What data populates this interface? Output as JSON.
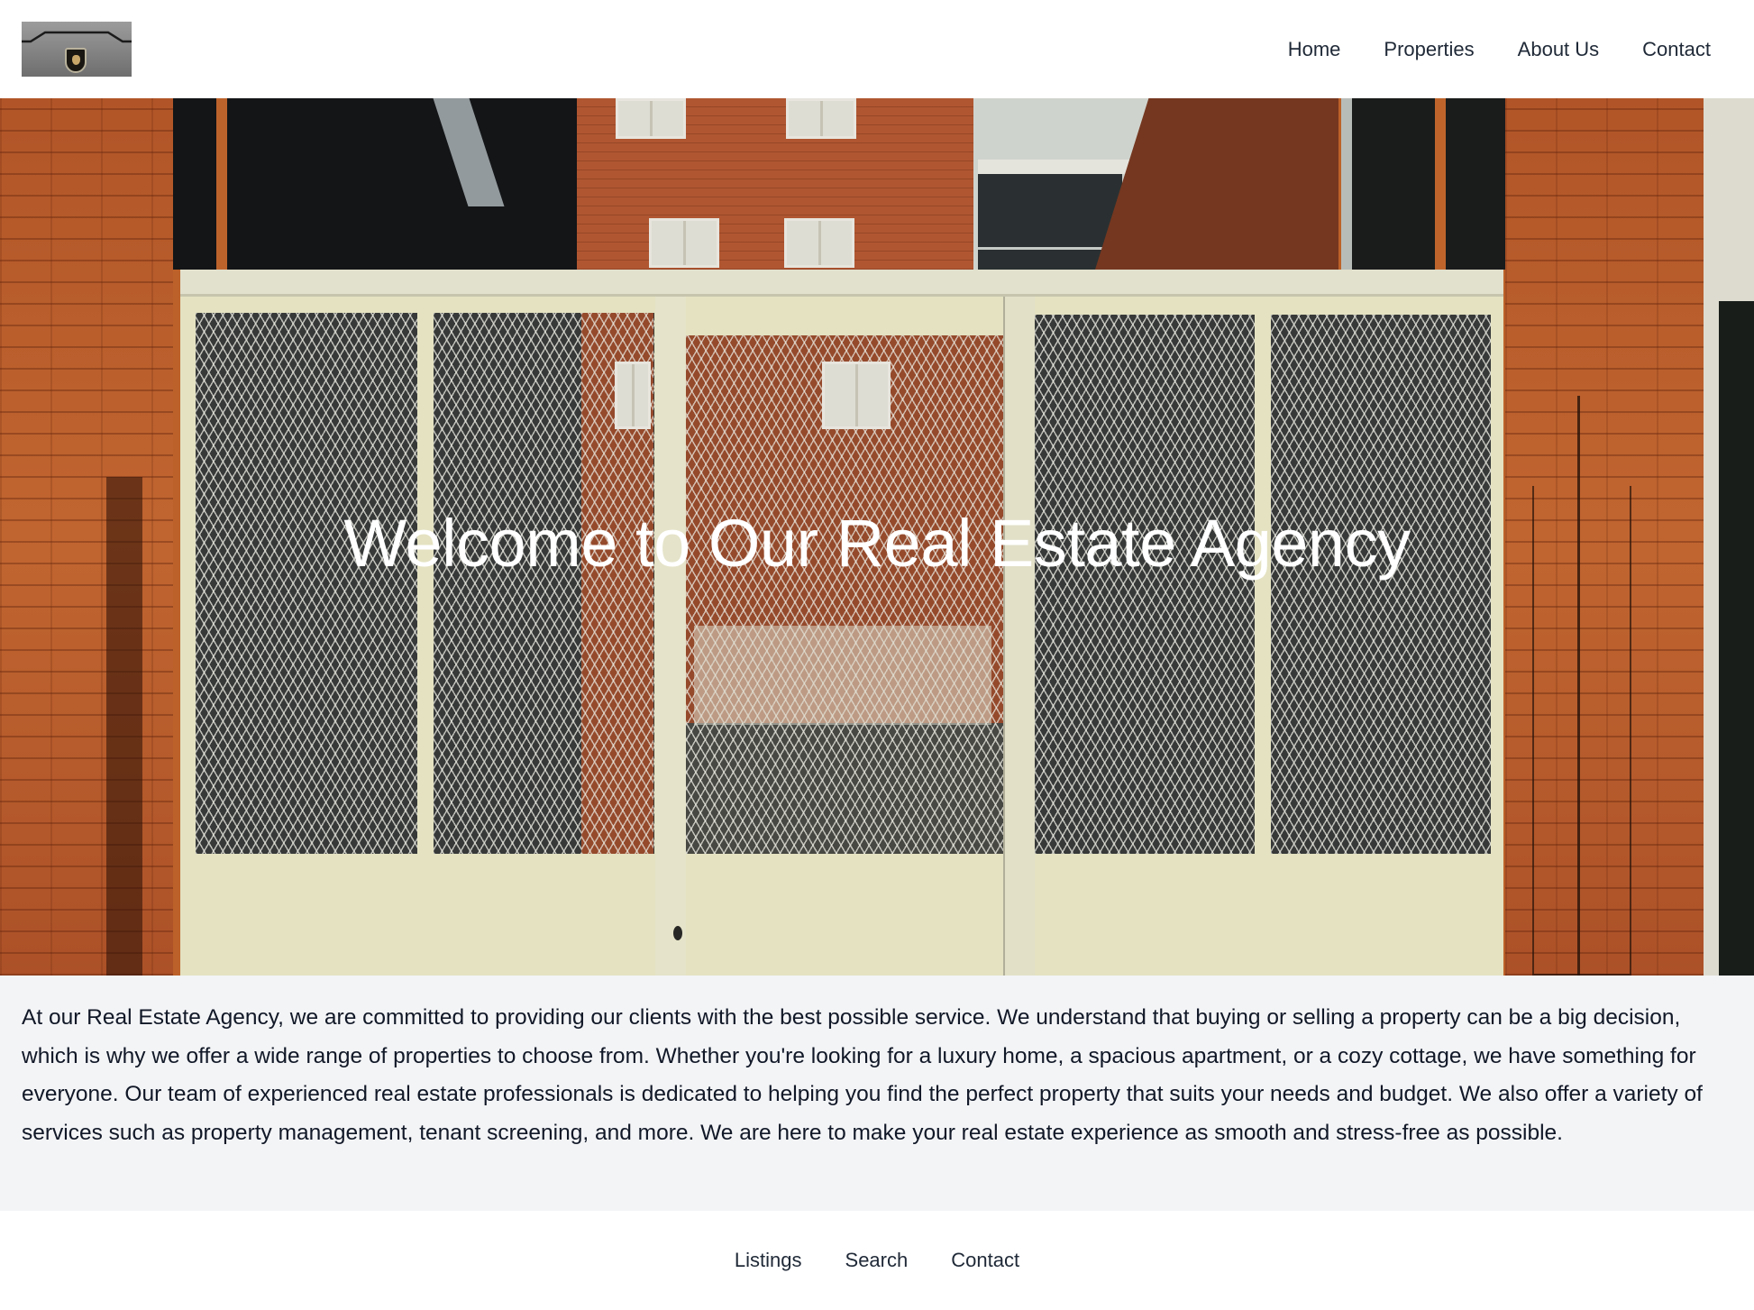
{
  "header": {
    "logo": {
      "icon": "car-hood-emblem-logo",
      "alt": "Agency logo"
    },
    "nav": [
      {
        "label": "Home"
      },
      {
        "label": "Properties"
      },
      {
        "label": "About Us"
      },
      {
        "label": "Contact"
      }
    ]
  },
  "hero": {
    "title": "Welcome to Our Real Estate Agency",
    "image": "brick-buildings-behind-white-mesh-gate"
  },
  "about": {
    "text": "At our Real Estate Agency, we are committed to providing our clients with the best possible service. We understand that buying or selling a property can be a big decision, which is why we offer a wide range of properties to choose from. Whether you're looking for a luxury home, a spacious apartment, or a cozy cottage, we have something for everyone. Our team of experienced real estate professionals is dedicated to helping you find the perfect property that suits your needs and budget. We also offer a variety of services such as property management, tenant screening, and more. We are here to make your real estate experience as smooth and stress-free as possible."
  },
  "footer": {
    "links": [
      {
        "label": "Listings"
      },
      {
        "label": "Search"
      },
      {
        "label": "Contact"
      }
    ]
  },
  "colors": {
    "text": "#111827",
    "nav_text": "#1f2937",
    "about_bg": "#f3f4f6",
    "hero_title": "#ffffff"
  }
}
